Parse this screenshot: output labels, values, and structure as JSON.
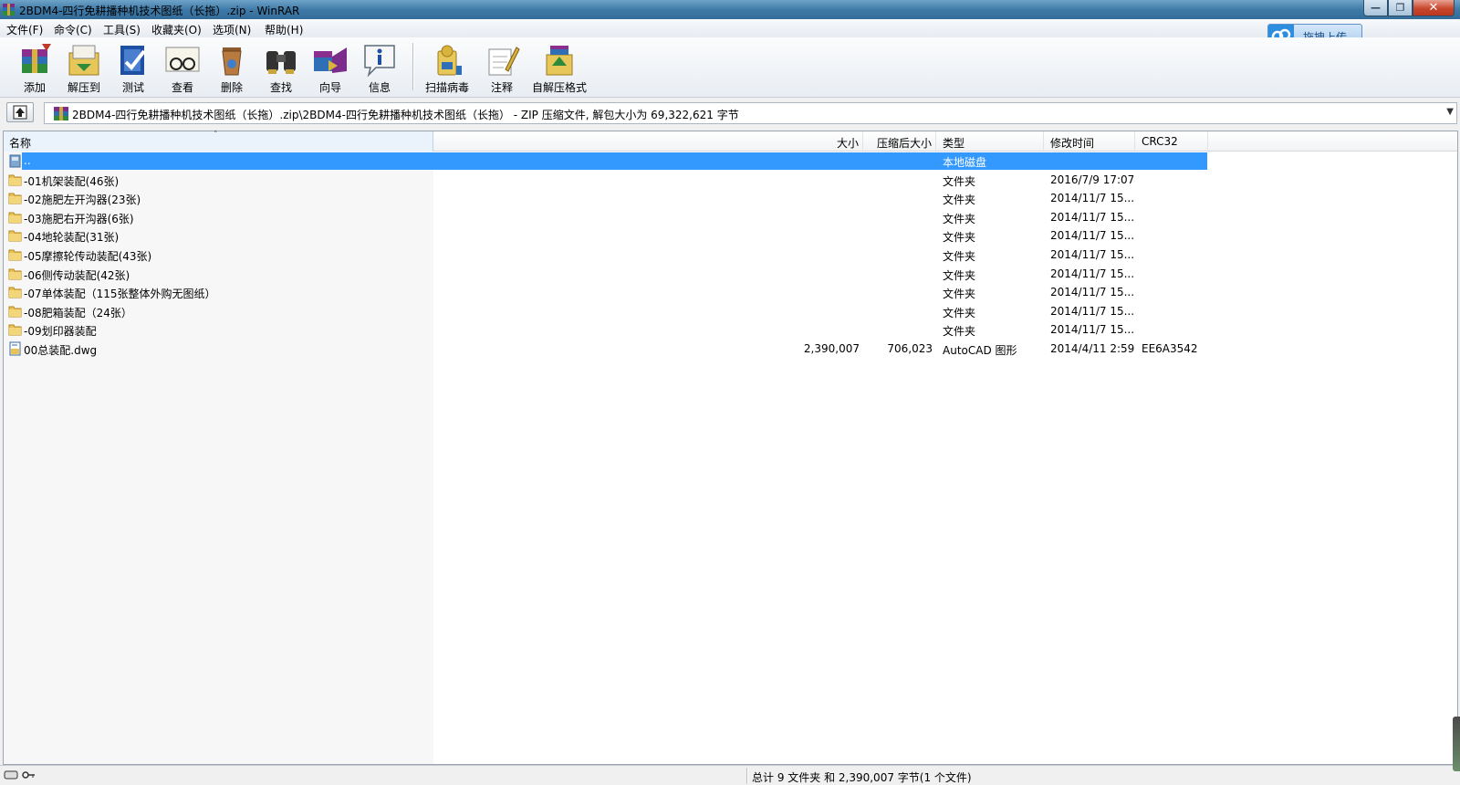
{
  "window": {
    "title": "2BDM4-四行免耕播种机技术图纸（长拖）.zip - WinRAR",
    "controls": [
      "minimize",
      "maximize",
      "close"
    ]
  },
  "menubar": {
    "items": [
      "文件(F)",
      "命令(C)",
      "工具(S)",
      "收藏夹(O)",
      "选项(N)",
      "帮助(H)"
    ],
    "cloud_button": "拖拽上传"
  },
  "toolbar": {
    "buttons": [
      {
        "label": "添加",
        "icon": "add-archive-icon"
      },
      {
        "label": "解压到",
        "icon": "extract-to-icon"
      },
      {
        "label": "测试",
        "icon": "test-icon"
      },
      {
        "label": "查看",
        "icon": "view-icon"
      },
      {
        "label": "删除",
        "icon": "delete-icon"
      },
      {
        "label": "查找",
        "icon": "find-icon"
      },
      {
        "label": "向导",
        "icon": "wizard-icon"
      },
      {
        "label": "信息",
        "icon": "info-icon"
      },
      {
        "label": "扫描病毒",
        "icon": "virus-scan-icon"
      },
      {
        "label": "注释",
        "icon": "comment-icon"
      },
      {
        "label": "自解压格式",
        "icon": "sfx-icon"
      }
    ]
  },
  "address": {
    "path": "2BDM4-四行免耕播种机技术图纸（长拖）.zip\\2BDM4-四行免耕播种机技术图纸（长拖） - ZIP 压缩文件, 解包大小为 69,322,621 字节"
  },
  "columns": {
    "name": "名称",
    "size": "大小",
    "packed": "压缩后大小",
    "type": "类型",
    "modified": "修改时间",
    "crc": "CRC32"
  },
  "rows": [
    {
      "name": "..",
      "size": "",
      "packed": "",
      "type": "本地磁盘",
      "modified": "",
      "crc": "",
      "icon": "parent-folder-icon",
      "selected": true
    },
    {
      "name": "-01机架装配(46张)",
      "size": "",
      "packed": "",
      "type": "文件夹",
      "modified": "2016/7/9 17:07",
      "crc": "",
      "icon": "folder-icon"
    },
    {
      "name": "-02施肥左开沟器(23张)",
      "size": "",
      "packed": "",
      "type": "文件夹",
      "modified": "2014/11/7 15...",
      "crc": "",
      "icon": "folder-icon"
    },
    {
      "name": "-03施肥右开沟器(6张)",
      "size": "",
      "packed": "",
      "type": "文件夹",
      "modified": "2014/11/7 15...",
      "crc": "",
      "icon": "folder-icon"
    },
    {
      "name": "-04地轮装配(31张)",
      "size": "",
      "packed": "",
      "type": "文件夹",
      "modified": "2014/11/7 15...",
      "crc": "",
      "icon": "folder-icon"
    },
    {
      "name": "-05摩擦轮传动装配(43张)",
      "size": "",
      "packed": "",
      "type": "文件夹",
      "modified": "2014/11/7 15...",
      "crc": "",
      "icon": "folder-icon"
    },
    {
      "name": "-06侧传动装配(42张)",
      "size": "",
      "packed": "",
      "type": "文件夹",
      "modified": "2014/11/7 15...",
      "crc": "",
      "icon": "folder-icon"
    },
    {
      "name": "-07单体装配（115张整体外购无图纸）",
      "size": "",
      "packed": "",
      "type": "文件夹",
      "modified": "2014/11/7 15...",
      "crc": "",
      "icon": "folder-icon"
    },
    {
      "name": "-08肥箱装配（24张）",
      "size": "",
      "packed": "",
      "type": "文件夹",
      "modified": "2014/11/7 15...",
      "crc": "",
      "icon": "folder-icon"
    },
    {
      "name": "-09划印器装配",
      "size": "",
      "packed": "",
      "type": "文件夹",
      "modified": "2014/11/7 15...",
      "crc": "",
      "icon": "folder-icon"
    },
    {
      "name": "00总装配.dwg",
      "size": "2,390,007",
      "packed": "706,023",
      "type": "AutoCAD 图形",
      "modified": "2014/4/11 2:59",
      "crc": "EE6A3542",
      "icon": "dwg-file-icon"
    }
  ],
  "status": {
    "text": "总计 9 文件夹 和 2,390,007 字节(1 个文件)"
  }
}
